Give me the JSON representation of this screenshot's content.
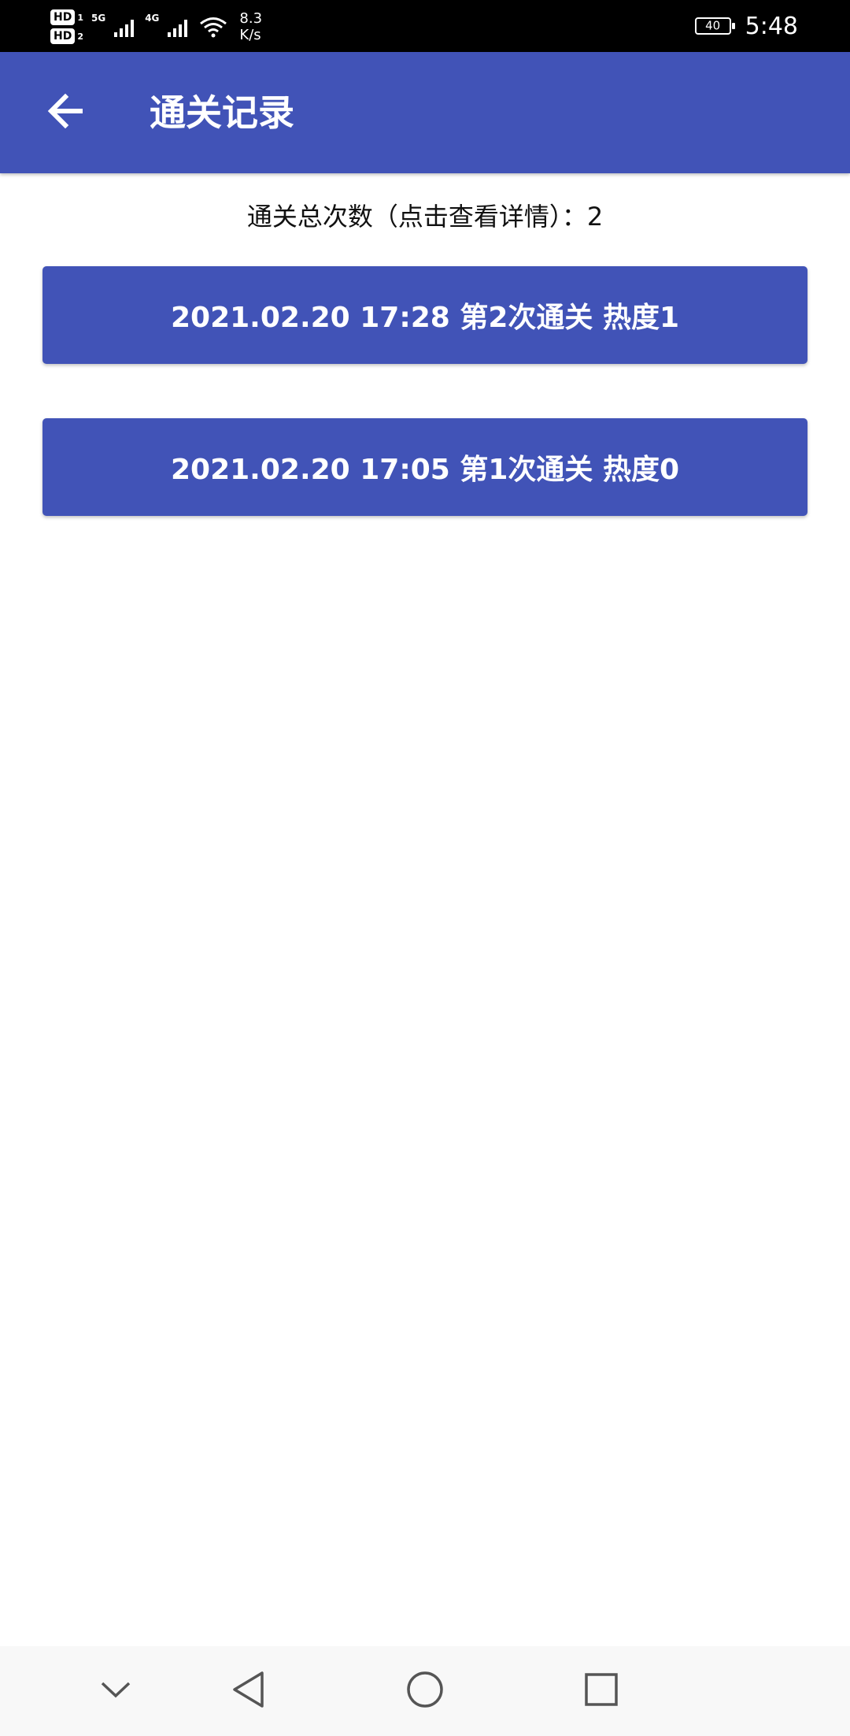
{
  "status_bar": {
    "sim1_label": "HD",
    "sim1_index": "1",
    "sim2_label": "HD",
    "sim2_index": "2",
    "network_1": "5G",
    "network_2": "4G",
    "speed_value": "8.3",
    "speed_unit": "K/s",
    "battery_level": "40",
    "time": "5:48",
    "icons": [
      "signal-icon",
      "signal-icon",
      "wifi-icon",
      "battery-icon"
    ]
  },
  "app_bar": {
    "title": "通关记录",
    "back_icon": "arrow-left-icon",
    "color": "#4153b7"
  },
  "summary": {
    "text": "通关总次数（点击查看详情）：2"
  },
  "records": [
    {
      "label": "2021.02.20 17:28 第2次通关 热度1"
    },
    {
      "label": "2021.02.20 17:05 第1次通关 热度0"
    }
  ],
  "nav_bar": {
    "icons": [
      "chevron-down-icon",
      "triangle-back-icon",
      "circle-home-icon",
      "square-recents-icon"
    ]
  },
  "colors": {
    "accent": "#4153b7",
    "status_bar": "#000000",
    "background": "#ffffff",
    "nav_bar": "#f8f8f8"
  }
}
